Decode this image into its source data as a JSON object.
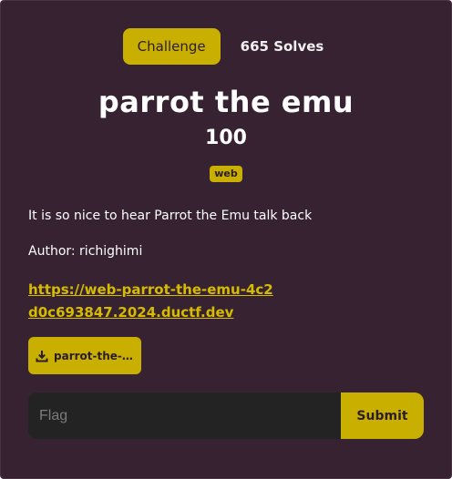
{
  "tabs": {
    "challenge_label": "Challenge",
    "solves_label": "665 Solves"
  },
  "challenge": {
    "name": "parrot the emu",
    "points": "100",
    "tag": "web",
    "description": "It is so nice to hear Parrot the Emu talk back",
    "author": "Author: richighimi",
    "link": "https://web-parrot-the-emu-4c2d0c693847.2024.ductf.dev",
    "file_label": "parrot-the-…"
  },
  "flag_form": {
    "placeholder": "Flag",
    "submit_label": "Submit"
  },
  "colors": {
    "background": "#362231",
    "accent": "#c9b000",
    "input_background": "#232323"
  },
  "icons": {
    "file": "download-icon"
  }
}
